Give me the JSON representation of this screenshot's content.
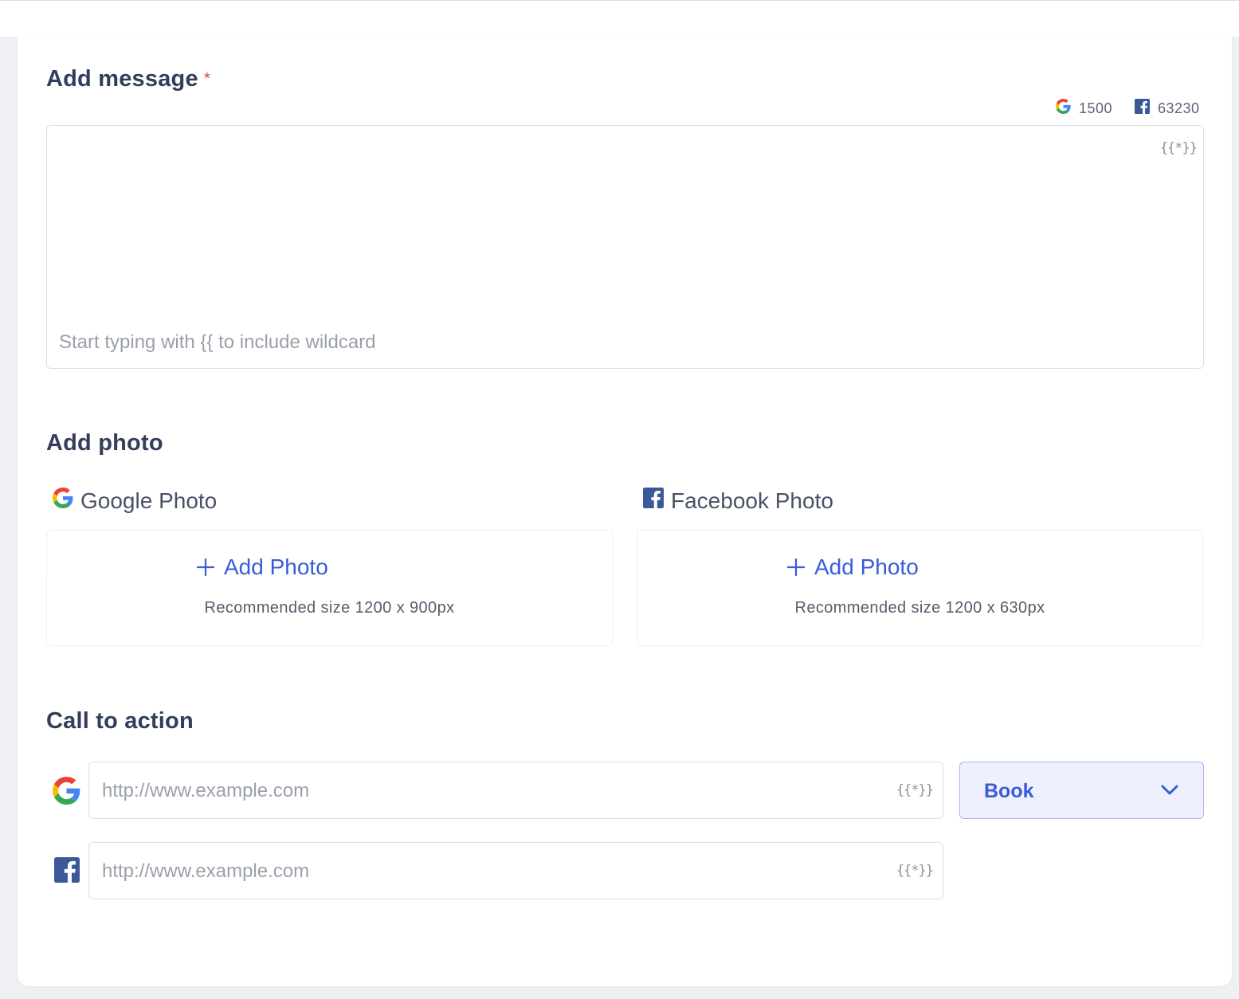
{
  "message": {
    "title": "Add message",
    "required_mark": "*",
    "google_count": "1500",
    "facebook_count": "63230",
    "wildcard_icon": "{{*}}",
    "placeholder": "Start typing with {{ to include wildcard"
  },
  "photo": {
    "title": "Add photo",
    "google": {
      "label": "Google Photo",
      "add_label": "Add Photo",
      "recommended": "Recommended size 1200 x 900px"
    },
    "facebook": {
      "label": "Facebook Photo",
      "add_label": "Add Photo",
      "recommended": "Recommended size 1200 x 630px"
    }
  },
  "cta": {
    "title": "Call to action",
    "google_url_placeholder": "http://www.example.com",
    "facebook_url_placeholder": "http://www.example.com",
    "wildcard_icon": "{{*}}",
    "action_selected": "Book"
  },
  "colors": {
    "accent": "#3b5bdb",
    "required": "#e0413a",
    "facebook": "#3b5998",
    "title": "#333d5c"
  },
  "icons": [
    "google-icon",
    "facebook-icon",
    "wildcard-icon",
    "plus-icon",
    "chevron-down-icon"
  ]
}
